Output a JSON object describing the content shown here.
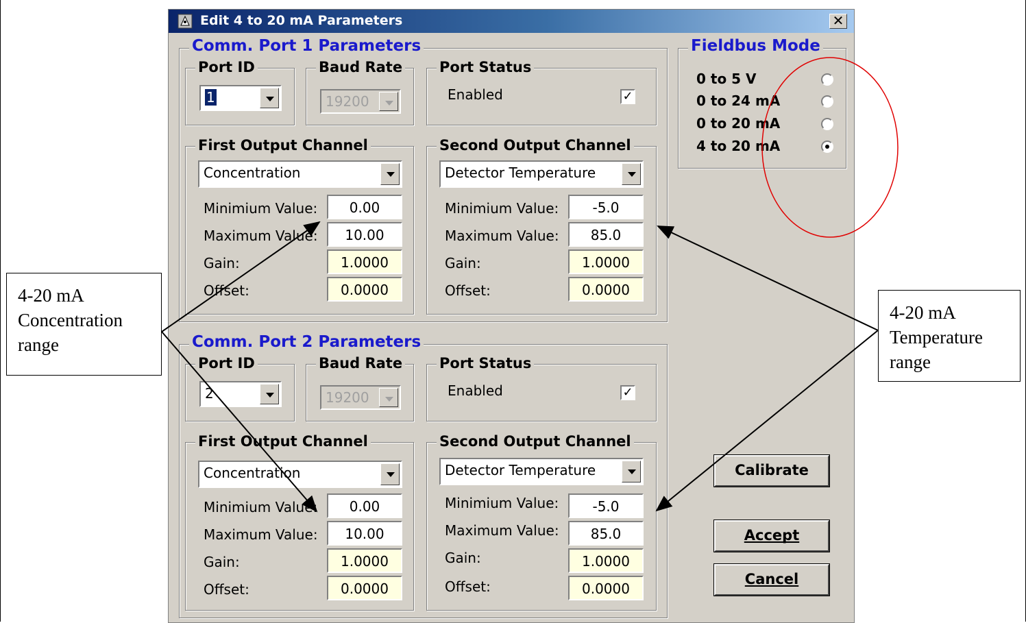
{
  "window": {
    "title": "Edit 4 to 20 mA Parameters",
    "close_glyph": "✕"
  },
  "port1": {
    "group_label": "Comm. Port 1 Parameters",
    "port_id_label": "Port ID",
    "port_id_value": "1",
    "baud_label": "Baud Rate",
    "baud_value": "19200",
    "status_label": "Port Status",
    "enabled_label": "Enabled",
    "enabled_checked": true,
    "first": {
      "label": "First Output Channel",
      "select": "Concentration",
      "min_label": "Minimium Value:",
      "min": "0.00",
      "max_label": "Maximum Value:",
      "max": "10.00",
      "gain_label": "Gain:",
      "gain": "1.0000",
      "offset_label": "Offset:",
      "offset": "0.0000"
    },
    "second": {
      "label": "Second Output Channel",
      "select": "Detector Temperature",
      "min_label": "Minimium Value:",
      "min": "-5.0",
      "max_label": "Maximum Value:",
      "max": "85.0",
      "gain_label": "Gain:",
      "gain": "1.0000",
      "offset_label": "Offset:",
      "offset": "0.0000"
    }
  },
  "port2": {
    "group_label": "Comm. Port 2 Parameters",
    "port_id_label": "Port ID",
    "port_id_value": "2",
    "baud_label": "Baud Rate",
    "baud_value": "19200",
    "status_label": "Port Status",
    "enabled_label": "Enabled",
    "enabled_checked": true,
    "first": {
      "label": "First Output Channel",
      "select": "Concentration",
      "min_label": "Minimium Value:",
      "min": "0.00",
      "max_label": "Maximum Value:",
      "max": "10.00",
      "gain_label": "Gain:",
      "gain": "1.0000",
      "offset_label": "Offset:",
      "offset": "0.0000"
    },
    "second": {
      "label": "Second Output Channel",
      "select": "Detector Temperature",
      "min_label": "Minimium Value:",
      "min": "-5.0",
      "max_label": "Maximum Value:",
      "max": "85.0",
      "gain_label": "Gain:",
      "gain": "1.0000",
      "offset_label": "Offset:",
      "offset": "0.0000"
    }
  },
  "fieldbus": {
    "label": "Fieldbus Mode",
    "options": [
      "0 to 5 V",
      "0 to 24 mA",
      "0 to 20 mA",
      "4 to 20 mA"
    ],
    "selected": "4 to 20 mA"
  },
  "buttons": {
    "calibrate": "Calibrate",
    "accept": "Accept",
    "cancel": "Cancel"
  },
  "callouts": {
    "left": [
      "4-20 mA",
      "Concentration",
      "range"
    ],
    "right": [
      "4-20 mA",
      "Temperature",
      "range"
    ]
  },
  "colors": {
    "dialog_bg": "#d4d0c8",
    "title_blue": "#0a246a",
    "group_label_blue": "#1a1acc",
    "readonly_field": "#ffffe1",
    "annotation_red": "#e00000"
  }
}
